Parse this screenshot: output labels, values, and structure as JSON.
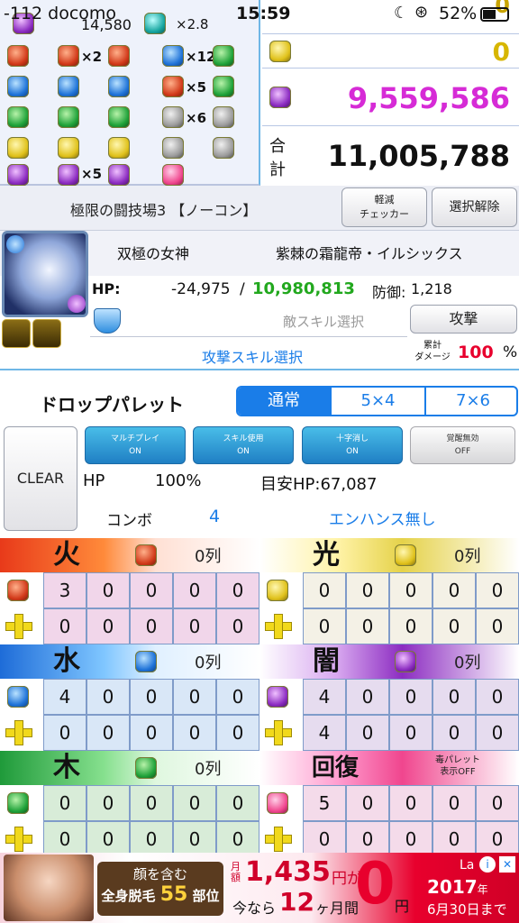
{
  "status": {
    "carrier": "-112 docomo",
    "time": "15:59",
    "battery": "52%"
  },
  "orb_panel": {
    "top_value": "14,580",
    "multiplier": "×2.8",
    "rows": [
      [
        "×2",
        "×12"
      ],
      [
        "",
        "×5"
      ],
      [
        "",
        "×6"
      ],
      [
        "",
        ""
      ],
      [
        "×5",
        ""
      ]
    ]
  },
  "totals": {
    "partial_top": "0",
    "light": "0",
    "dark": "9,559,586",
    "total_label_1": "合",
    "total_label_2": "計",
    "total": "11,005,788"
  },
  "dungeon": {
    "name": "極限の闘技場3 【ノーコン】",
    "checker_btn_1": "軽減",
    "checker_btn_2": "チェッカー",
    "clear_btn": "選択解除"
  },
  "monster": {
    "leader": "双極の女神",
    "enemy": "紫棘の霜龍帝・イルシックス",
    "hp_label": "HP:",
    "hp_delta": "-24,975",
    "slash": "/",
    "hp_max": "10,980,813",
    "defense_label": "防御:",
    "defense": "1,218"
  },
  "skills": {
    "enemy_skill_placeholder": "敵スキル選択",
    "attack_btn": "攻撃",
    "attack_skill": "攻撃スキル選択",
    "cum_dmg_1": "累計",
    "cum_dmg_2": "ダメージ",
    "pct": "100",
    "pct_unit": "%"
  },
  "palette": {
    "title": "ドロップパレット",
    "tabs": [
      "通常",
      "5×4",
      "7×6"
    ],
    "clear": "CLEAR",
    "toggles": [
      {
        "label": "マルチプレイ",
        "state": "ON"
      },
      {
        "label": "スキル使用",
        "state": "ON"
      },
      {
        "label": "十字消し",
        "state": "ON"
      },
      {
        "label": "覚醒無効",
        "state": "OFF"
      }
    ],
    "hp_label": "HP",
    "hp_pct": "100%",
    "target_hp": "目安HP:67,087",
    "combo_label": "コンボ",
    "combo": "4",
    "enhance": "エンハンス無し"
  },
  "boards": [
    {
      "name": "火",
      "count": "0列",
      "row1": [
        "3",
        "0",
        "0",
        "0",
        "0"
      ],
      "row2": [
        "0",
        "0",
        "0",
        "0",
        "0"
      ]
    },
    {
      "name": "光",
      "count": "0列",
      "row1": [
        "0",
        "0",
        "0",
        "0",
        "0"
      ],
      "row2": [
        "0",
        "0",
        "0",
        "0",
        "0"
      ]
    },
    {
      "name": "水",
      "count": "0列",
      "row1": [
        "4",
        "0",
        "0",
        "0",
        "0"
      ],
      "row2": [
        "0",
        "0",
        "0",
        "0",
        "0"
      ]
    },
    {
      "name": "闇",
      "count": "0列",
      "row1": [
        "4",
        "0",
        "0",
        "0",
        "0"
      ],
      "row2": [
        "4",
        "0",
        "0",
        "0",
        "0"
      ]
    },
    {
      "name": "木",
      "count": "0列",
      "row1": [
        "0",
        "0",
        "0",
        "0",
        "0"
      ],
      "row2": [
        "0",
        "0",
        "0",
        "0",
        "0"
      ]
    },
    {
      "name": "回復",
      "count": "",
      "row1": [
        "5",
        "0",
        "0",
        "0",
        "0"
      ],
      "row2": [
        "0",
        "0",
        "0",
        "0",
        "0"
      ]
    }
  ],
  "poison_toggle": {
    "line1": "毒パレット",
    "line2": "表示OFF"
  },
  "ad": {
    "line1": "顔を含む",
    "line2": "全身脱毛",
    "count": "55",
    "unit": "部位",
    "price_label": "月額",
    "price": "1,435",
    "price_unit": "円が",
    "promo_pre": "今なら",
    "months": "12",
    "promo_post": "ヶ月間",
    "zero": "0",
    "yen": "円",
    "year": "2017",
    "year_unit": "年",
    "deadline": "6月30日まで",
    "brand": "La"
  }
}
